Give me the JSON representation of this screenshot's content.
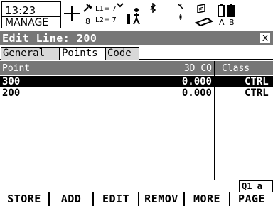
{
  "status": {
    "time": "13:23",
    "mode": "MANAGE",
    "sat_l1": "L1= 7",
    "sat_l2": "L2= 7",
    "sat_count": "8",
    "battery_label_a": "A",
    "battery_label_b": "B"
  },
  "title": {
    "text": "Edit Line: 200",
    "close_label": "X"
  },
  "tabs": [
    {
      "label": "General",
      "active": false
    },
    {
      "label": "Points",
      "active": true
    },
    {
      "label": "Code",
      "active": false
    }
  ],
  "table": {
    "headers": [
      "Point",
      "3D CQ",
      "Class"
    ],
    "rows": [
      {
        "point": "300",
        "cq": "0.000",
        "class": "CTRL",
        "selected": true
      },
      {
        "point": "200",
        "cq": "0.000",
        "class": "CTRL",
        "selected": false
      }
    ]
  },
  "page_indicator": "Q1 a ⇧",
  "softkeys": [
    "STORE",
    "ADD",
    "EDIT",
    "REMOV",
    "MORE",
    "PAGE"
  ]
}
